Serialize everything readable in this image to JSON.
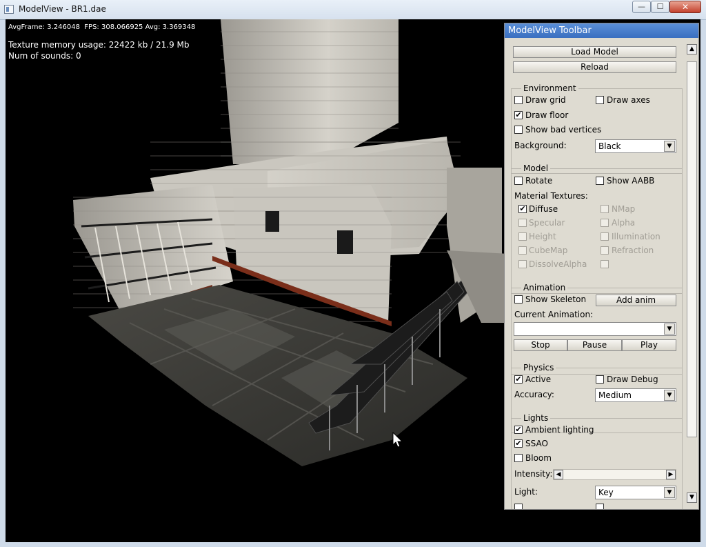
{
  "window": {
    "title": "ModelView - BR1.dae",
    "min_symbol": "—",
    "max_symbol": "☐",
    "close_symbol": "✕",
    "icon": "app-window-icon"
  },
  "hud": {
    "line1": "AvgFrame: 3.246048  FPS: 308.066925 Avg: 3.369348",
    "line2": "Texture memory usage: 22422 kb / 21.9 Mb",
    "line3": "Num of sounds: 0"
  },
  "toolbar": {
    "title": "ModelView Toolbar",
    "load_model": "Load Model",
    "reload": "Reload",
    "environment": {
      "title": "Environment",
      "draw_grid": {
        "label": "Draw grid",
        "checked": false
      },
      "draw_axes": {
        "label": "Draw axes",
        "checked": false
      },
      "draw_floor": {
        "label": "Draw floor",
        "checked": true
      },
      "show_bad_vertices": {
        "label": "Show bad vertices",
        "checked": false
      },
      "background_label": "Background:",
      "background_value": "Black"
    },
    "model": {
      "title": "Model",
      "rotate": {
        "label": "Rotate",
        "checked": false
      },
      "show_aabb": {
        "label": "Show AABB",
        "checked": false
      },
      "material_textures_label": "Material Textures:",
      "textures": [
        {
          "label": "Diffuse",
          "checked": true,
          "enabled": true
        },
        {
          "label": "NMap",
          "checked": false,
          "enabled": false
        },
        {
          "label": "Specular",
          "checked": false,
          "enabled": false
        },
        {
          "label": "Alpha",
          "checked": false,
          "enabled": false
        },
        {
          "label": "Height",
          "checked": false,
          "enabled": false
        },
        {
          "label": "Illumination",
          "checked": false,
          "enabled": false
        },
        {
          "label": "CubeMap",
          "checked": false,
          "enabled": false
        },
        {
          "label": "Refraction",
          "checked": false,
          "enabled": false
        },
        {
          "label": "DissolveAlpha",
          "checked": false,
          "enabled": false
        },
        {
          "label": "",
          "checked": false,
          "enabled": false
        }
      ]
    },
    "animation": {
      "title": "Animation",
      "show_skeleton": {
        "label": "Show Skeleton",
        "checked": false
      },
      "add_anim": "Add anim",
      "current_animation_label": "Current Animation:",
      "current_animation_value": "",
      "stop": "Stop",
      "pause": "Pause",
      "play": "Play"
    },
    "physics": {
      "title": "Physics",
      "active": {
        "label": "Active",
        "checked": true
      },
      "draw_debug": {
        "label": "Draw Debug",
        "checked": false
      },
      "accuracy_label": "Accuracy:",
      "accuracy_value": "Medium"
    },
    "lights": {
      "title": "Lights",
      "ambient_lighting": {
        "label": "Ambient lighting",
        "checked": true
      },
      "ssao": {
        "label": "SSAO",
        "checked": true
      },
      "bloom": {
        "label": "Bloom",
        "checked": false
      },
      "intensity_label": "Intensity:",
      "light_label": "Light:",
      "light_value": "Key"
    },
    "check_mark": "✔",
    "dropdown_arrow": "▼",
    "scroll_up": "▲",
    "scroll_down": "▼",
    "slider_left": "◀",
    "slider_right": "▶"
  }
}
